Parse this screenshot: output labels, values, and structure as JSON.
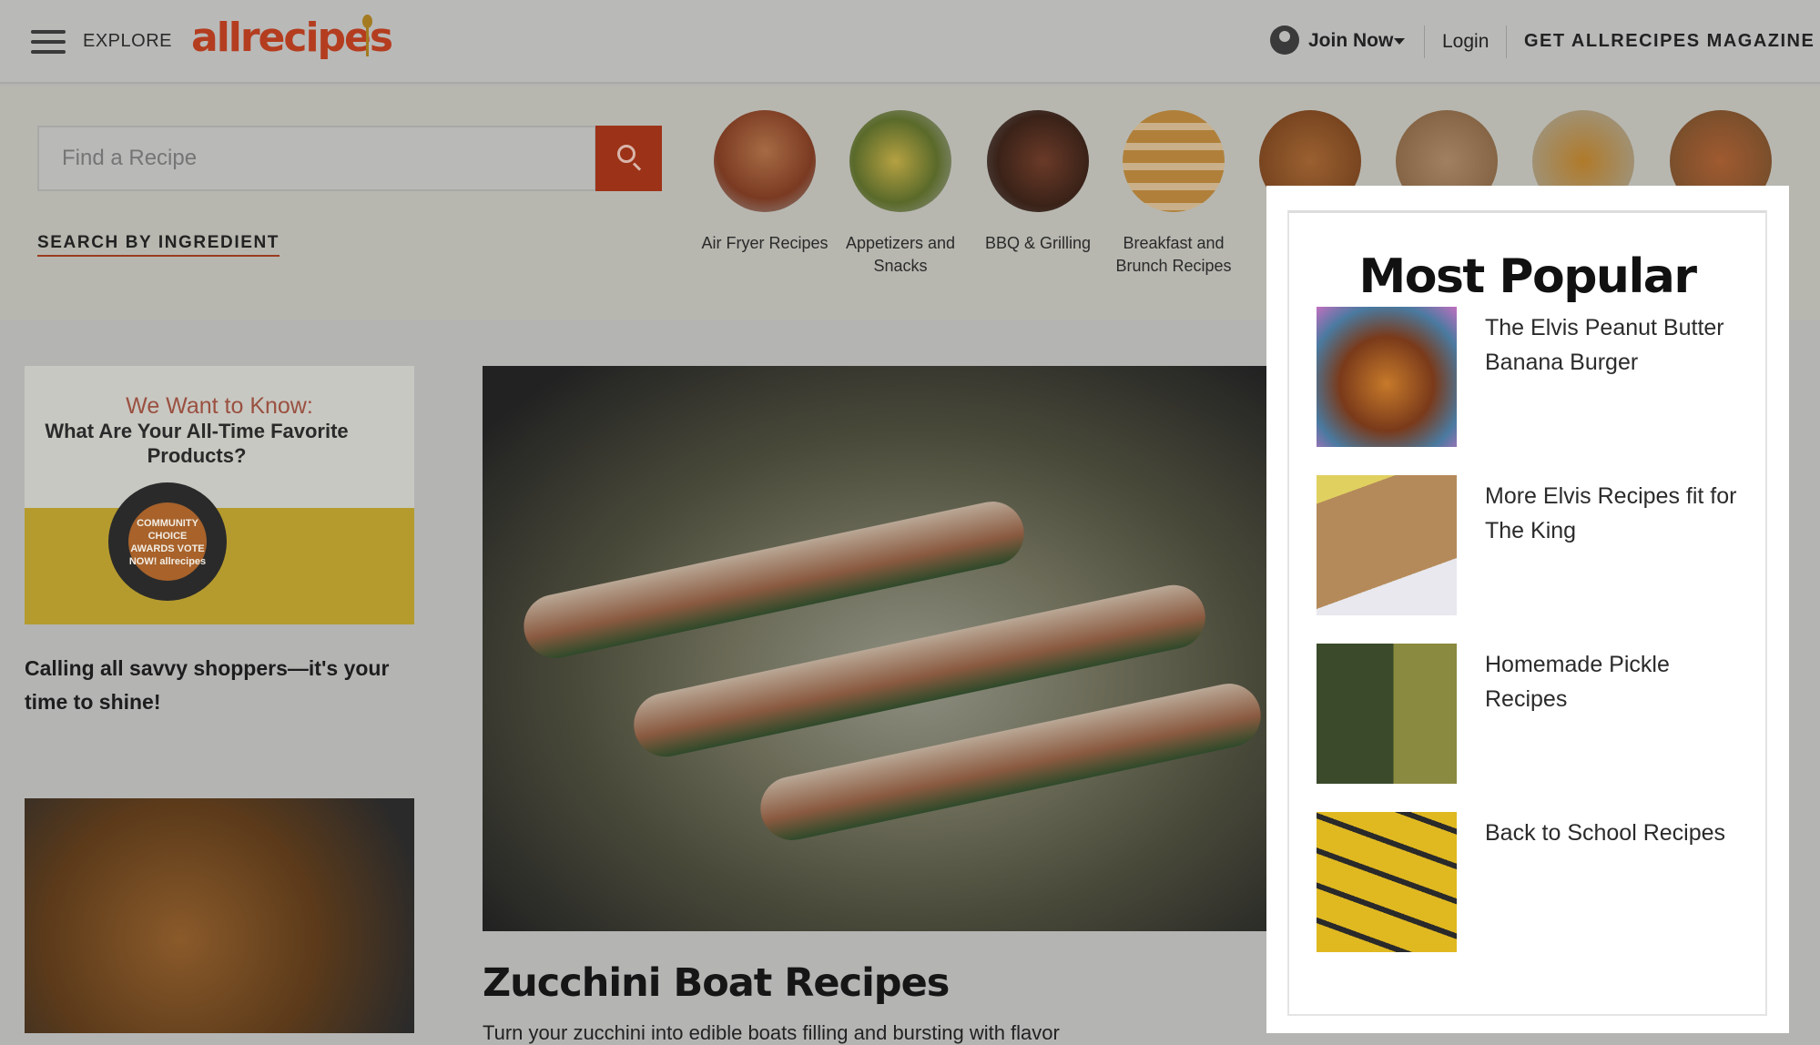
{
  "header": {
    "explore_label": "EXPLORE",
    "logo_text": "allrecipes",
    "join_label": "Join Now",
    "login_label": "Login",
    "magazine_label": "GET ALLRECIPES MAGAZINE"
  },
  "search": {
    "placeholder": "Find a Recipe",
    "by_ingredient_label": "SEARCH BY INGREDIENT"
  },
  "categories": [
    {
      "label": "Air Fryer Recipes"
    },
    {
      "label": "Appetizers and Snacks"
    },
    {
      "label": "BBQ & Grilling"
    },
    {
      "label": "Breakfast and Brunch Recipes"
    },
    {
      "label": ""
    },
    {
      "label": ""
    },
    {
      "label": ""
    },
    {
      "label": ""
    }
  ],
  "ad": {
    "headline": "We Want to Know:",
    "subhead": "What Are Your All-Time Favorite Products?",
    "badge_text": "COMMUNITY CHOICE AWARDS VOTE NOW! allrecipes",
    "caption": "Calling all savvy shoppers—it's your time to shine!"
  },
  "hero": {
    "title": "Zucchini Boat Recipes",
    "description": "Turn your zucchini into edible boats filling and bursting with flavor"
  },
  "popular": {
    "title": "Most Popular",
    "items": [
      {
        "label": "The Elvis Peanut Butter Banana Burger"
      },
      {
        "label": "More Elvis Recipes fit for The King"
      },
      {
        "label": "Homemade Pickle Recipes"
      },
      {
        "label": "Back to School Recipes"
      }
    ]
  },
  "colors": {
    "brand": "#c94520",
    "overlay_dim": "#b4b4b3"
  }
}
